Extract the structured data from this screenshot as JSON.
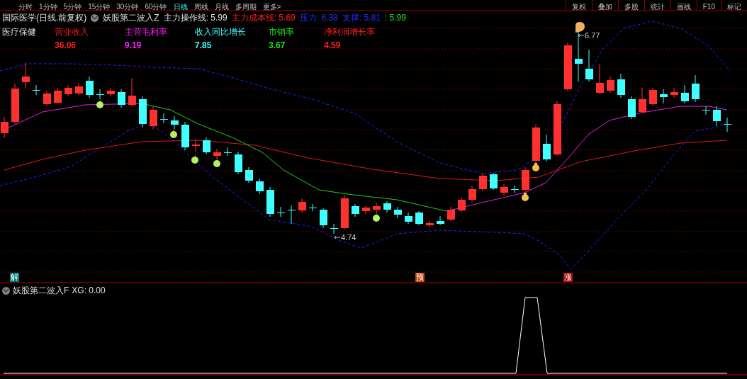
{
  "period_tabs": [
    {
      "label": "分时",
      "selected": false
    },
    {
      "label": "1分钟",
      "selected": false
    },
    {
      "label": "5分钟",
      "selected": false
    },
    {
      "label": "15分钟",
      "selected": false
    },
    {
      "label": "30分钟",
      "selected": false
    },
    {
      "label": "60分钟",
      "selected": false
    },
    {
      "label": "日线",
      "selected": true
    },
    {
      "label": "周线",
      "selected": false
    },
    {
      "label": "月线",
      "selected": false
    },
    {
      "label": "多周期",
      "selected": false
    },
    {
      "label": "更多>",
      "selected": false
    }
  ],
  "toolbar_buttons": [
    "复权",
    "叠加",
    "多股",
    "统计",
    "画线",
    "F10",
    "标记"
  ],
  "main_panel": {
    "title": "国际医学(日线.前复权)",
    "indicator": "妖股第二波入Z",
    "readings": [
      {
        "text": "主力操作线: 5.99",
        "color": "#e0e0e0"
      },
      {
        "text": "主力成本线: 5.69",
        "color": "#ff2020"
      },
      {
        "text": "压力: 6.38",
        "color": "#2030ff"
      },
      {
        "text": "支撑: 5.81",
        "color": "#2030ff"
      },
      {
        "text": ": 5.99",
        "color": "#20e020"
      }
    ],
    "sector": "医疗保健",
    "metrics": [
      {
        "label": "营业收入",
        "value": "36.06",
        "color": "#ff2020"
      },
      {
        "label": "主营毛利率",
        "value": "9.19",
        "color": "#ff20ff"
      },
      {
        "label": "收入同比增长",
        "value": "7.85",
        "color": "#40ffff"
      },
      {
        "label": "市销率",
        "value": "3.67",
        "color": "#20e020"
      },
      {
        "label": "净利润增长率",
        "value": "4.59",
        "color": "#ff2020"
      }
    ],
    "high_label": "6.77",
    "low_label": "4.74",
    "signals": [
      {
        "text": "解",
        "color": "#007a7a"
      },
      {
        "text": "预",
        "color": "#c04810"
      },
      {
        "text": "涨",
        "color": "#a01010"
      }
    ]
  },
  "sub_panel": {
    "indicator": "妖股第二波入F",
    "reading": "XG: 0.00"
  }
}
